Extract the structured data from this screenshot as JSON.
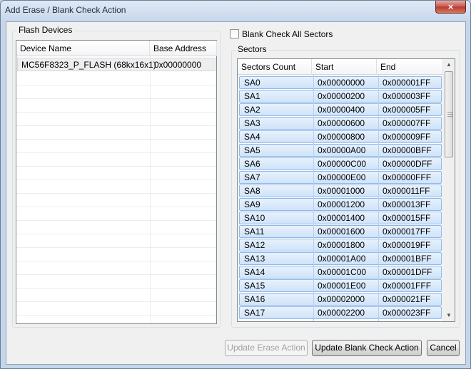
{
  "window": {
    "title": "Add Erase / Blank Check Action",
    "close_glyph": "×"
  },
  "flash_devices": {
    "label": "Flash Devices",
    "columns": [
      "Device Name",
      "Base Address"
    ],
    "rows": [
      {
        "device": "MC56F8323_P_FLASH (68kx16x1)",
        "base": "0x00000000"
      }
    ]
  },
  "blank_check_all": {
    "label": "Blank Check All Sectors",
    "checked": false
  },
  "sectors": {
    "label": "Sectors",
    "columns": [
      "Sectors Count",
      "Start",
      "End"
    ],
    "rows": [
      {
        "name": "SA0",
        "start": "0x00000000",
        "end": "0x000001FF"
      },
      {
        "name": "SA1",
        "start": "0x00000200",
        "end": "0x000003FF"
      },
      {
        "name": "SA2",
        "start": "0x00000400",
        "end": "0x000005FF"
      },
      {
        "name": "SA3",
        "start": "0x00000600",
        "end": "0x000007FF"
      },
      {
        "name": "SA4",
        "start": "0x00000800",
        "end": "0x000009FF"
      },
      {
        "name": "SA5",
        "start": "0x00000A00",
        "end": "0x00000BFF"
      },
      {
        "name": "SA6",
        "start": "0x00000C00",
        "end": "0x00000DFF"
      },
      {
        "name": "SA7",
        "start": "0x00000E00",
        "end": "0x00000FFF"
      },
      {
        "name": "SA8",
        "start": "0x00001000",
        "end": "0x000011FF"
      },
      {
        "name": "SA9",
        "start": "0x00001200",
        "end": "0x000013FF"
      },
      {
        "name": "SA10",
        "start": "0x00001400",
        "end": "0x000015FF"
      },
      {
        "name": "SA11",
        "start": "0x00001600",
        "end": "0x000017FF"
      },
      {
        "name": "SA12",
        "start": "0x00001800",
        "end": "0x000019FF"
      },
      {
        "name": "SA13",
        "start": "0x00001A00",
        "end": "0x00001BFF"
      },
      {
        "name": "SA14",
        "start": "0x00001C00",
        "end": "0x00001DFF"
      },
      {
        "name": "SA15",
        "start": "0x00001E00",
        "end": "0x00001FFF"
      },
      {
        "name": "SA16",
        "start": "0x00002000",
        "end": "0x000021FF"
      },
      {
        "name": "SA17",
        "start": "0x00002200",
        "end": "0x000023FF"
      }
    ]
  },
  "buttons": {
    "update_erase": "Update Erase Action",
    "update_blank": "Update Blank Check Action",
    "cancel": "Cancel"
  },
  "icons": {
    "scroll_up": "scroll-up-icon",
    "scroll_down": "scroll-down-icon"
  }
}
